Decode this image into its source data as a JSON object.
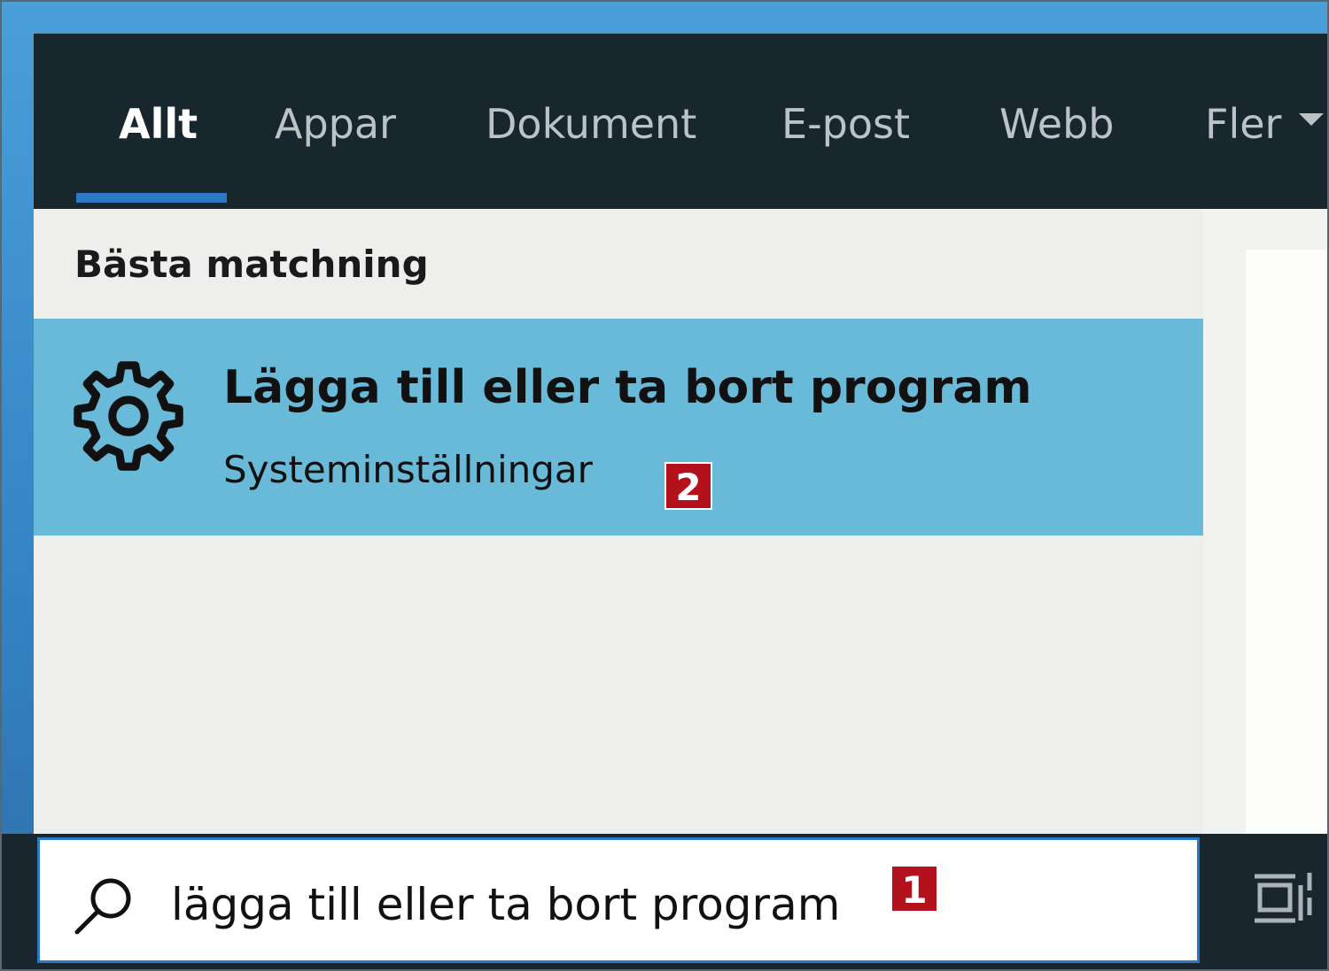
{
  "tabs": [
    {
      "label": "Allt",
      "active": true
    },
    {
      "label": "Appar"
    },
    {
      "label": "Dokument"
    },
    {
      "label": "E-post"
    },
    {
      "label": "Webb"
    },
    {
      "label": "Fler"
    }
  ],
  "section": {
    "title": "Bästa matchning"
  },
  "best_match": {
    "title": "Lägga till eller ta bort program",
    "subtitle": "Systeminställningar",
    "icon": "gear-icon"
  },
  "search": {
    "value": "lägga till eller ta bort program",
    "icon": "search-icon"
  },
  "callouts": {
    "one": "1",
    "two": "2",
    "color": "#b3111b"
  },
  "colors": {
    "accent": "#2d78c2",
    "header_bg": "#18262d",
    "selected_bg": "#69b9d9"
  }
}
